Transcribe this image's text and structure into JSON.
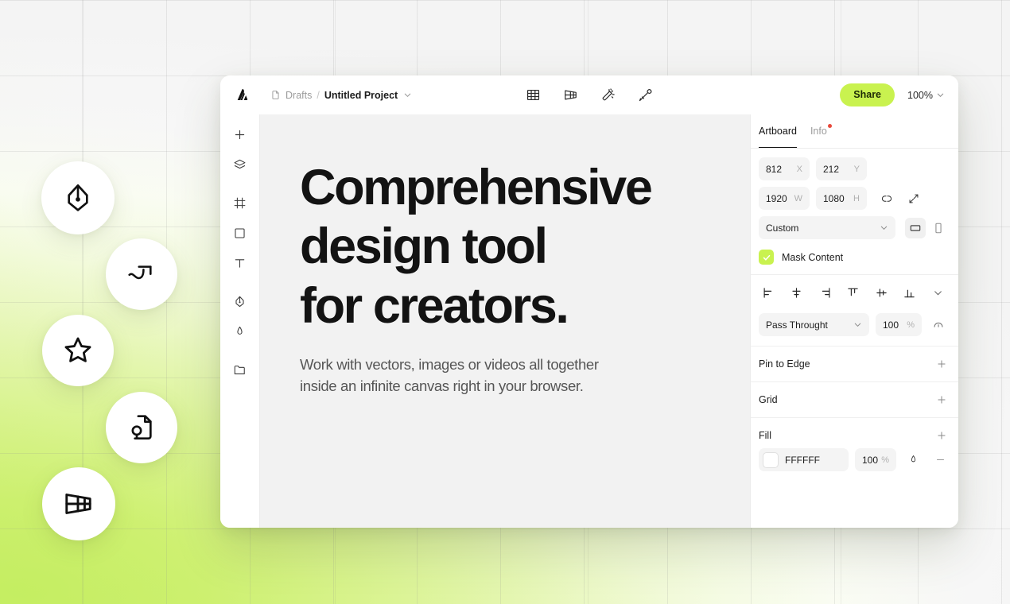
{
  "background": {
    "accent_green": "#c5ee63",
    "bubbles": [
      {
        "icon": "pen-nib-icon",
        "name": "bubble-pen-tool"
      },
      {
        "icon": "bezier-curve-icon",
        "name": "bubble-bezier-curve"
      },
      {
        "icon": "star-icon",
        "name": "bubble-shapes"
      },
      {
        "icon": "document-idea-icon",
        "name": "bubble-document-idea"
      },
      {
        "icon": "perspective-grid-icon",
        "name": "bubble-perspective-grid"
      }
    ]
  },
  "header": {
    "logo_name": "app-logo",
    "breadcrumb": {
      "file_icon": "file-icon",
      "parent": "Drafts",
      "separator": "/",
      "title": "Untitled Project",
      "caret": "chevron-down-icon"
    },
    "tools": [
      {
        "name": "grid-tool",
        "icon": "grid-icon"
      },
      {
        "name": "perspective-tool",
        "icon": "perspective-grid-icon"
      },
      {
        "name": "magic-wand-tool",
        "icon": "magic-wand-icon"
      },
      {
        "name": "brush-tool",
        "icon": "brush-icon"
      }
    ],
    "share_label": "Share",
    "share_bg": "#c9f24f",
    "zoom_level": "100%"
  },
  "left_rail": [
    {
      "name": "add-tool",
      "icon": "plus-icon"
    },
    {
      "name": "layers-tool",
      "icon": "layers-icon"
    },
    {
      "name": "artboard-tool",
      "icon": "frame-icon"
    },
    {
      "name": "rectangle-tool",
      "icon": "rectangle-icon"
    },
    {
      "name": "text-tool",
      "icon": "text-icon"
    },
    {
      "name": "pen-tool",
      "icon": "pen-nib-icon"
    },
    {
      "name": "pencil-tool",
      "icon": "pencil-icon"
    },
    {
      "name": "assets-tool",
      "icon": "folder-icon"
    }
  ],
  "canvas": {
    "headline": "Comprehensive\ndesign tool\nfor creators.",
    "subline": "Work with vectors, images or videos all together\ninside an infinite canvas right in your browser."
  },
  "right_panel": {
    "tabs": [
      {
        "label": "Artboard",
        "active": true,
        "badge": false
      },
      {
        "label": "Info",
        "active": false,
        "badge": true,
        "badge_color": "#e8493b"
      }
    ],
    "position": {
      "x_value": "812",
      "x_unit": "X",
      "y_value": "212",
      "y_unit": "Y",
      "w_value": "1920",
      "w_unit": "W",
      "h_value": "1080",
      "h_unit": "H",
      "link_icon": "unlink-icon",
      "scale_icon": "resize-arrows-icon"
    },
    "preset": {
      "value": "Custom",
      "caret": "chevron-down-icon",
      "orientation": [
        {
          "name": "orientation-landscape",
          "icon": "landscape-icon",
          "selected": true
        },
        {
          "name": "orientation-portrait",
          "icon": "portrait-icon",
          "selected": false
        }
      ]
    },
    "mask": {
      "label": "Mask Content",
      "checked": true,
      "check_bg": "#c9f24f"
    },
    "align_icons": [
      {
        "name": "align-left-button",
        "icon": "align-left-icon"
      },
      {
        "name": "align-center-horizontal-button",
        "icon": "align-center-horizontal-icon"
      },
      {
        "name": "align-right-button",
        "icon": "align-right-icon"
      },
      {
        "name": "align-top-button",
        "icon": "align-top-icon"
      },
      {
        "name": "align-center-vertical-button",
        "icon": "align-center-vertical-icon"
      },
      {
        "name": "align-bottom-button",
        "icon": "align-bottom-icon"
      },
      {
        "name": "align-more-button",
        "icon": "chevron-down-icon"
      }
    ],
    "blend": {
      "mode": "Pass Throught",
      "caret": "chevron-down-icon",
      "opacity": "100",
      "opacity_unit": "%",
      "effects_icon": "opacity-icon"
    },
    "sections": [
      {
        "label": "Pin to Edge",
        "action": "plus-icon"
      },
      {
        "label": "Grid",
        "action": "plus-icon"
      }
    ],
    "fill": {
      "label": "Fill",
      "add_icon": "plus-icon",
      "swatch_color": "#ffffff",
      "hex": "FFFFFF",
      "opacity": "100",
      "opacity_unit": "%",
      "eyedropper_icon": "droplet-icon",
      "remove_icon": "minus-icon"
    }
  }
}
